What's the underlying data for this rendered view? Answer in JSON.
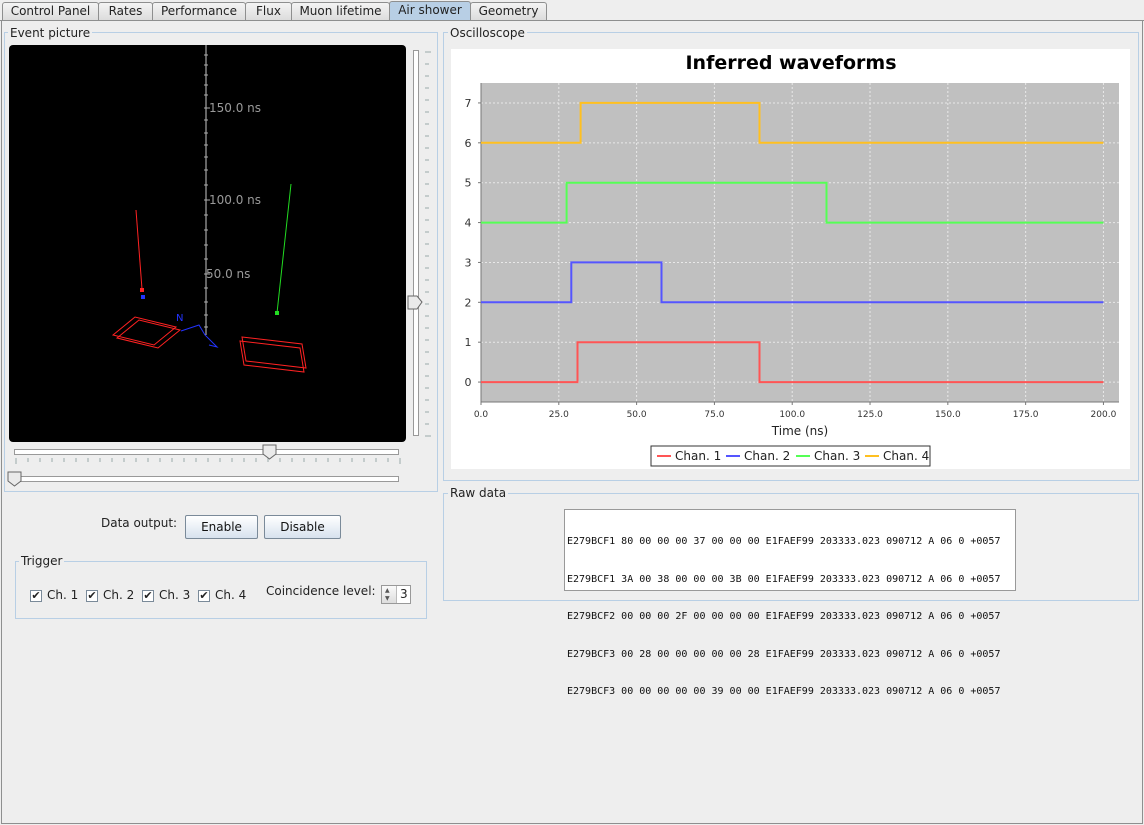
{
  "tabs": [
    {
      "label": "Control Panel",
      "active": false
    },
    {
      "label": "Rates",
      "active": false
    },
    {
      "label": "Performance",
      "active": false
    },
    {
      "label": "Flux",
      "active": false
    },
    {
      "label": "Muon lifetime",
      "active": false
    },
    {
      "label": "Air shower",
      "active": true
    },
    {
      "label": "Geometry",
      "active": false
    }
  ],
  "event_picture": {
    "title": "Event picture",
    "axis_labels": [
      "150.0 ns",
      "100.0 ns",
      "50.0 ns"
    ],
    "north_label": "N"
  },
  "data_output": {
    "label": "Data output:",
    "enable_label": "Enable",
    "disable_label": "Disable"
  },
  "trigger": {
    "title": "Trigger",
    "channels": [
      {
        "label": "Ch. 1",
        "checked": true
      },
      {
        "label": "Ch. 2",
        "checked": true
      },
      {
        "label": "Ch. 3",
        "checked": true
      },
      {
        "label": "Ch. 4",
        "checked": true
      }
    ],
    "coincidence_label": "Coincidence level:",
    "coincidence_value": "3"
  },
  "oscilloscope": {
    "title": "Oscilloscope"
  },
  "chart_data": {
    "type": "line",
    "title": "Inferred waveforms",
    "xlabel": "Time (ns)",
    "ylabel": "",
    "xlim": [
      0,
      205
    ],
    "ylim": [
      -0.5,
      7.5
    ],
    "xticks": [
      0,
      25,
      50,
      75,
      100,
      125,
      150,
      175,
      200
    ],
    "xtick_labels": [
      "0.0",
      "25.0",
      "50.0",
      "75.0",
      "100.0",
      "125.0",
      "150.0",
      "175.0",
      "200.0"
    ],
    "yticks": [
      0,
      1,
      2,
      3,
      4,
      5,
      6,
      7
    ],
    "ytick_labels": [
      "0",
      "1",
      "2",
      "3",
      "4",
      "5",
      "6",
      "7"
    ],
    "grid": true,
    "legend_placement": "bottom",
    "series": [
      {
        "name": "Chan. 1",
        "color": "#ff5555",
        "x": [
          0,
          31,
          31,
          89.5,
          89.5,
          200
        ],
        "y": [
          0,
          0,
          1,
          1,
          0,
          0
        ]
      },
      {
        "name": "Chan. 2",
        "color": "#5555ff",
        "x": [
          0,
          29,
          29,
          58,
          58,
          200
        ],
        "y": [
          2,
          2,
          3,
          3,
          2,
          2
        ]
      },
      {
        "name": "Chan. 3",
        "color": "#55ff55",
        "x": [
          0,
          27.5,
          27.5,
          111,
          111,
          200
        ],
        "y": [
          4,
          4,
          5,
          5,
          4,
          4
        ]
      },
      {
        "name": "Chan. 4",
        "color": "#ffc020",
        "x": [
          0,
          32,
          32,
          89.5,
          89.5,
          200
        ],
        "y": [
          6,
          6,
          7,
          7,
          6,
          6
        ]
      }
    ]
  },
  "raw_data": {
    "title": "Raw data",
    "lines": [
      "E279BCF1 80 00 00 00 37 00 00 00 E1FAEF99 203333.023 090712 A 06 0 +0057",
      "E279BCF1 3A 00 38 00 00 00 3B 00 E1FAEF99 203333.023 090712 A 06 0 +0057",
      "E279BCF2 00 00 00 2F 00 00 00 00 E1FAEF99 203333.023 090712 A 06 0 +0057",
      "E279BCF3 00 28 00 00 00 00 00 28 E1FAEF99 203333.023 090712 A 06 0 +0057",
      "E279BCF3 00 00 00 00 00 39 00 00 E1FAEF99 203333.023 090712 A 06 0 +0057"
    ]
  }
}
